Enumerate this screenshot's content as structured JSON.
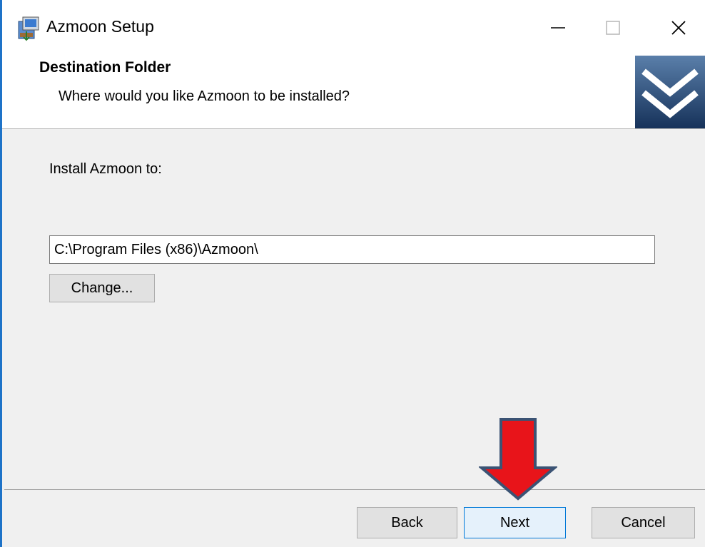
{
  "window": {
    "title": "Azmoon Setup",
    "controls": {
      "minimize": "—",
      "maximize": "☐",
      "close": "✕"
    }
  },
  "header": {
    "title": "Destination Folder",
    "subtitle": "Where would you like Azmoon to be installed?"
  },
  "main": {
    "install_label": "Install Azmoon to:",
    "path_value": "C:\\Program Files (x86)\\Azmoon\\",
    "change_label": "Change..."
  },
  "footer": {
    "back_label": "Back",
    "next_label": "Next",
    "cancel_label": "Cancel"
  },
  "colors": {
    "accent": "#0078d7",
    "banner": "#1f3f6b",
    "annotation_arrow": "#e8141a",
    "annotation_arrow_border": "#3b5374"
  }
}
